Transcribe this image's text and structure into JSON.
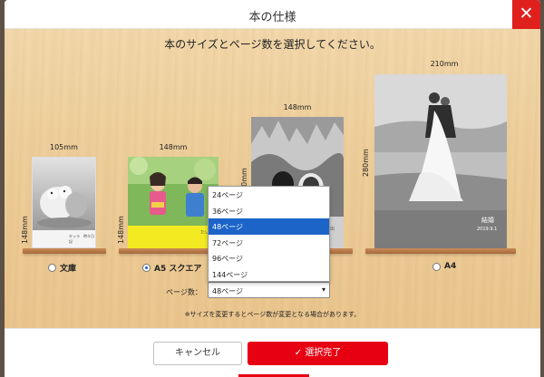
{
  "dialog": {
    "title": "本の仕様",
    "close_label": "✕",
    "instruction": "本のサイズとページ数を選択してください。",
    "note": "※サイズを変更するとページ数が変更となる場合があります。"
  },
  "books": [
    {
      "id": "bunko",
      "width_label": "105mm",
      "height_label": "148mm",
      "option_label": "文庫",
      "selected": false,
      "cover_text": "キッラ　時々日記"
    },
    {
      "id": "a5-square",
      "width_label": "148mm",
      "height_label": "148mm",
      "option_label": "A5 スクエア",
      "selected": true,
      "cover_text": "たい"
    },
    {
      "id": "a5",
      "width_label": "148mm",
      "height_label": "210mm",
      "option_label": "",
      "selected": false,
      "cover_text": "思出"
    },
    {
      "id": "a4",
      "width_label": "210mm",
      "height_label": "280mm",
      "option_label": "A4",
      "selected": false,
      "cover_text": "結婚",
      "cover_subtext": "2019.9.1"
    }
  ],
  "pages": {
    "label": "ページ数：",
    "selected": "48ページ",
    "options": [
      "24ページ",
      "36ページ",
      "48ページ",
      "72ページ",
      "96ページ",
      "144ページ"
    ],
    "arrow": "▾"
  },
  "footer": {
    "cancel_label": "キャンセル",
    "confirm_label": "選択完了",
    "confirm_icon": "✓"
  },
  "colors": {
    "accent_red": "#e60012",
    "selection_blue": "#1c64c8",
    "shelf_brown": "#b97a48"
  }
}
